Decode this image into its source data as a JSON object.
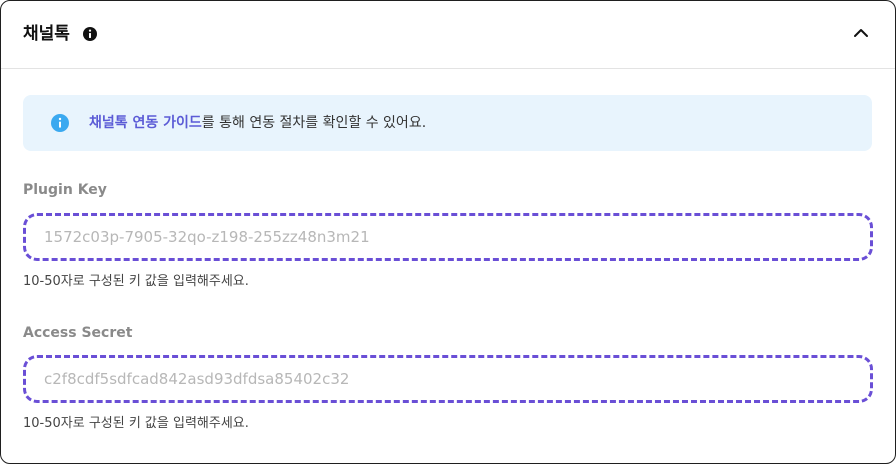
{
  "header": {
    "title": "채널톡",
    "title_icon": "info-filled-icon",
    "collapse_icon": "chevron-up-icon"
  },
  "notice": {
    "icon": "info-circle-icon",
    "link_text": "채널톡 연동 가이드",
    "rest_text": "를 통해 연동 절차를 확인할 수 있어요.",
    "background_color": "#e8f4fd",
    "link_color": "#5b5bd6"
  },
  "fields": [
    {
      "label": "Plugin Key",
      "value": "",
      "placeholder": "1572c03p-7905-32qo-z198-255zz48n3m21",
      "help": "10-50자로 구성된 키 값을 입력해주세요."
    },
    {
      "label": "Access Secret",
      "value": "",
      "placeholder": "c2f8cdf5sdfcad842asd93dfdsa85402c32",
      "help": "10-50자로 구성된 키 값을 입력해주세요."
    }
  ],
  "colors": {
    "accent": "#6a4fd6",
    "label_gray": "#8a8a8a"
  }
}
